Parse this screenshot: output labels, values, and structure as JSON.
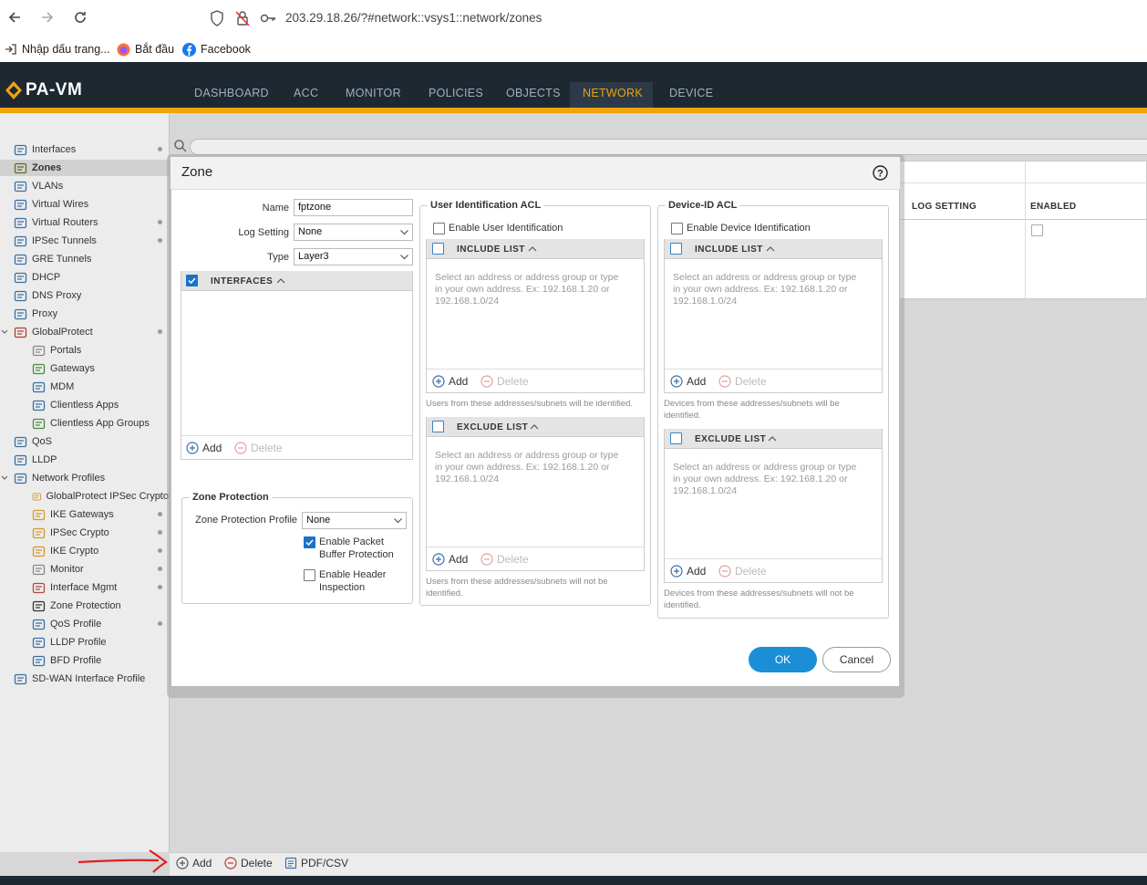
{
  "browser": {
    "url": "203.29.18.26/?#network::vsys1::network/zones",
    "bookmarks": [
      "Nhập dấu trang...",
      "Bắt đầu",
      "Facebook"
    ]
  },
  "app": {
    "logo": "PA-VM",
    "tabs": [
      "DASHBOARD",
      "ACC",
      "MONITOR",
      "POLICIES",
      "OBJECTS",
      "NETWORK",
      "DEVICE"
    ],
    "active_tab": "NETWORK",
    "accent_color": "#f0a30a"
  },
  "sidebar": {
    "items": [
      {
        "label": "Interfaces",
        "icon": "interfaces-icon"
      },
      {
        "label": "Zones",
        "icon": "zones-icon",
        "selected": true
      },
      {
        "label": "VLANs",
        "icon": "vlans-icon"
      },
      {
        "label": "Virtual Wires",
        "icon": "virtual-wires-icon"
      },
      {
        "label": "Virtual Routers",
        "icon": "virtual-routers-icon"
      },
      {
        "label": "IPSec Tunnels",
        "icon": "ipsec-tunnels-icon"
      },
      {
        "label": "GRE Tunnels",
        "icon": "gre-tunnels-icon"
      },
      {
        "label": "DHCP",
        "icon": "dhcp-icon"
      },
      {
        "label": "DNS Proxy",
        "icon": "dns-proxy-icon"
      },
      {
        "label": "Proxy",
        "icon": "proxy-icon"
      },
      {
        "label": "GlobalProtect",
        "icon": "globalprotect-icon"
      },
      {
        "label": "Portals",
        "icon": "portals-icon"
      },
      {
        "label": "Gateways",
        "icon": "gateways-icon"
      },
      {
        "label": "MDM",
        "icon": "mdm-icon"
      },
      {
        "label": "Clientless Apps",
        "icon": "clientless-apps-icon"
      },
      {
        "label": "Clientless App Groups",
        "icon": "clientless-app-groups-icon"
      },
      {
        "label": "QoS",
        "icon": "qos-icon"
      },
      {
        "label": "LLDP",
        "icon": "lldp-icon"
      },
      {
        "label": "Network Profiles",
        "icon": "network-profiles-icon"
      },
      {
        "label": "GlobalProtect IPSec Crypto",
        "icon": "lock-icon"
      },
      {
        "label": "IKE Gateways",
        "icon": "ike-gateways-icon"
      },
      {
        "label": "IPSec Crypto",
        "icon": "lock-icon"
      },
      {
        "label": "IKE Crypto",
        "icon": "lock-icon"
      },
      {
        "label": "Monitor",
        "icon": "monitor-icon"
      },
      {
        "label": "Interface Mgmt",
        "icon": "interface-mgmt-icon"
      },
      {
        "label": "Zone Protection",
        "icon": "zone-protection-icon"
      },
      {
        "label": "QoS Profile",
        "icon": "qos-profile-icon"
      },
      {
        "label": "LLDP Profile",
        "icon": "lldp-profile-icon"
      },
      {
        "label": "BFD Profile",
        "icon": "bfd-profile-icon"
      },
      {
        "label": "SD-WAN Interface Profile",
        "icon": "sdwan-icon"
      }
    ]
  },
  "table": {
    "headers": [
      "LOG SETTING",
      "ENABLED"
    ]
  },
  "bottom_toolbar": {
    "add": "Add",
    "delete": "Delete",
    "pdf_csv": "PDF/CSV"
  },
  "modal": {
    "title": "Zone",
    "name_label": "Name",
    "name_value": "fptzone",
    "log_setting_label": "Log Setting",
    "log_setting_value": "None",
    "type_label": "Type",
    "type_value": "Layer3",
    "interfaces_header": "INTERFACES",
    "interfaces_checked": true,
    "add": "Add",
    "delete": "Delete",
    "zone_protection": {
      "title": "Zone Protection",
      "profile_label": "Zone Protection Profile",
      "profile_value": "None",
      "packet_buffer_line1": "Enable Packet",
      "packet_buffer_line2": "Buffer Protection",
      "packet_buffer_checked": true,
      "header_insp_line1": "Enable Header",
      "header_insp_line2": "Inspection",
      "header_insp_checked": false
    },
    "user_acl": {
      "title": "User Identification ACL",
      "enable_label": "Enable User Identification",
      "include_header": "INCLUDE LIST",
      "exclude_header": "EXCLUDE LIST",
      "placeholder_line1": "Select an address or address group or type",
      "placeholder_line2": "in your own address. Ex: 192.168.1.20 or",
      "placeholder_line3": "192.168.1.0/24",
      "include_note": "Users from these addresses/subnets will be identified.",
      "exclude_note_line1": "Users from these addresses/subnets will not be",
      "exclude_note_line2": "identified."
    },
    "device_acl": {
      "title": "Device-ID ACL",
      "enable_label": "Enable Device Identification",
      "include_header": "INCLUDE LIST",
      "exclude_header": "EXCLUDE LIST",
      "include_note_line1": "Devices from these addresses/subnets will be",
      "include_note_line2": "identified.",
      "exclude_note_line1": "Devices from these addresses/subnets will not be",
      "exclude_note_line2": "identified."
    },
    "ok": "OK",
    "cancel": "Cancel"
  }
}
